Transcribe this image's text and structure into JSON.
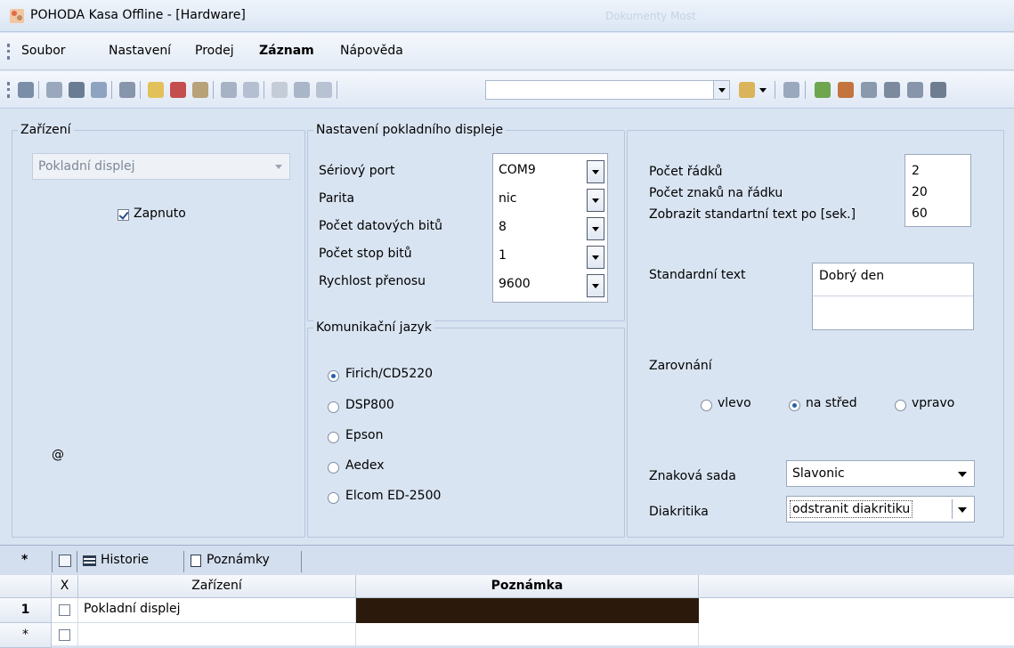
{
  "window": {
    "title": "POHODA Kasa Offline - [Hardware]",
    "faded_right": "Dokumenty Most"
  },
  "menu": [
    {
      "label": "Soubor",
      "bold": false
    },
    {
      "label": "Nastavení",
      "bold": false
    },
    {
      "label": "Prodej",
      "bold": false
    },
    {
      "label": "Záznam",
      "bold": true
    },
    {
      "label": "Nápověda",
      "bold": false
    }
  ],
  "device_group": {
    "legend": "Zařízení",
    "device_select": "Pokladní displej",
    "enabled_label": "Zapnuto",
    "enabled": true,
    "at_symbol": "@"
  },
  "display_group": {
    "legend": "Nastavení pokladního displeje",
    "fields": [
      {
        "label": "Sériový port",
        "value": "COM9"
      },
      {
        "label": "Parita",
        "value": "nic"
      },
      {
        "label": "Počet datových bitů",
        "value": "8"
      },
      {
        "label": "Počet stop bitů",
        "value": "1"
      },
      {
        "label": "Rychlost přenosu",
        "value": "9600"
      }
    ]
  },
  "lang_group": {
    "legend": "Komunikační jazyk",
    "options": [
      "Firich/CD5220",
      "DSP800",
      "Epson",
      "Aedex",
      "Elcom ED-2500"
    ],
    "selected": "Firich/CD5220"
  },
  "right_group": {
    "rows_label": "Počet řádků",
    "rows_value": "2",
    "chars_label": "Počet znaků na řádku",
    "chars_value": "20",
    "show_label": "Zobrazit standartní text po [sek.]",
    "show_value": "60",
    "std_text_label": "Standardní text",
    "std_text_line1": "Dobrý den",
    "std_text_line2": "",
    "align_label": "Zarovnání",
    "align_options": [
      "vlevo",
      "na střed",
      "vpravo"
    ],
    "align_selected": "na střed",
    "charset_label": "Znaková sada",
    "charset_value": "Slavonic",
    "diacritics_label": "Diakritika",
    "diacritics_value": "odstranit diakritiku"
  },
  "tabs": {
    "star": "*",
    "history": "Historie",
    "notes": "Poznámky"
  },
  "grid": {
    "col_x": "X",
    "col_device": "Zařízení",
    "col_note": "Poznámka",
    "rows": [
      {
        "num": "1",
        "device": "Pokladní displej",
        "note": ""
      }
    ],
    "new_row_marker": "*"
  },
  "colors": {
    "accent": "#2a5fa8",
    "note_cell": "#2b1a0b",
    "background": "#d9e4f2"
  }
}
